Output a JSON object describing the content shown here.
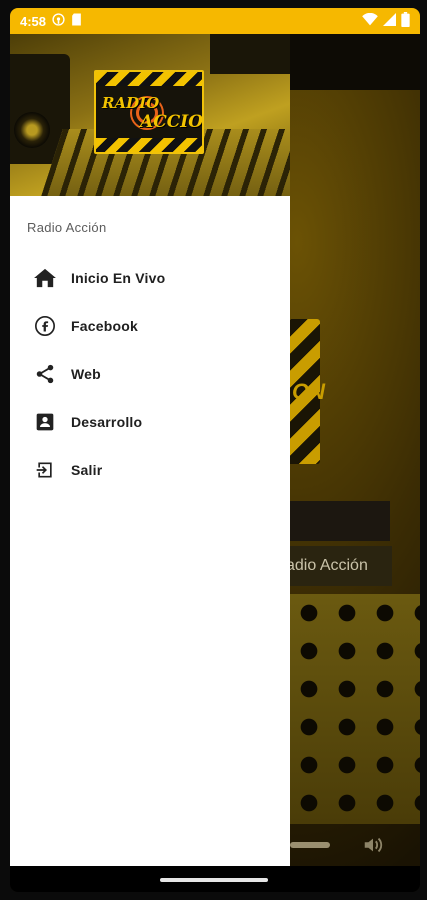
{
  "status_bar": {
    "time": "4:58",
    "color": "#f6b800",
    "left_icons": [
      "podcast-icon",
      "sd-card-icon"
    ],
    "right_icons": [
      "wifi-icon",
      "signal-icon",
      "battery-icon"
    ]
  },
  "drawer": {
    "section_title": "Radio Acción",
    "logo_line_1": "RADIO",
    "logo_line_2": "ACCION",
    "items": [
      {
        "label": "Inicio En Vivo",
        "icon": "home-icon"
      },
      {
        "label": "Facebook",
        "icon": "facebook-icon"
      },
      {
        "label": "Web",
        "icon": "share-icon"
      },
      {
        "label": "Desarrollo",
        "icon": "contact-card-icon"
      },
      {
        "label": "Salir",
        "icon": "exit-icon"
      }
    ]
  },
  "background_app": {
    "station_name": "adio Acción",
    "logo_fragment": "ON",
    "accent": "#c99d00"
  }
}
